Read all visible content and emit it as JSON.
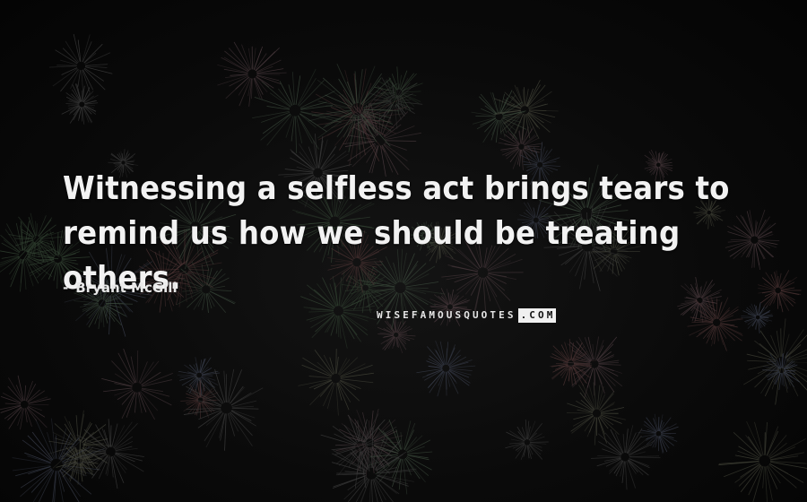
{
  "quote": {
    "line1": "Witnessing a selfless act brings tears to",
    "line2": "remind us how we should be treating others."
  },
  "author": {
    "dash": "-",
    "name": "Bryant McGill"
  },
  "watermark": {
    "main": "WISEFAMOUSQUOTES",
    "tld": ".COM"
  },
  "background": {
    "description_colors": [
      "#0a0a0a",
      "#3a4a3a",
      "#5a3a3a",
      "#3a3a4a"
    ]
  }
}
